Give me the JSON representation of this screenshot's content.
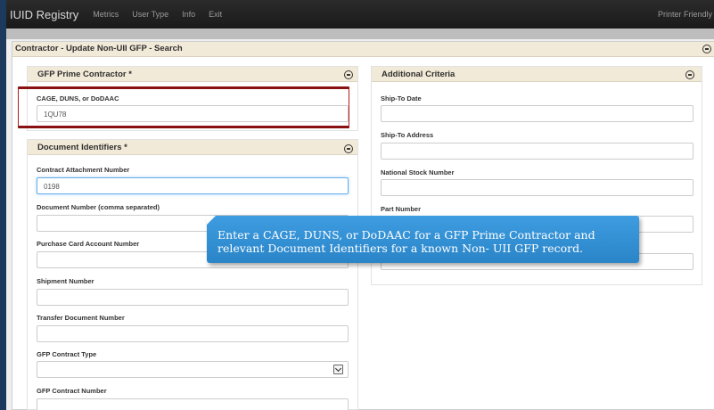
{
  "navbar": {
    "brand": "IUID Registry",
    "links": [
      "Metrics",
      "User Type",
      "Info",
      "Exit"
    ],
    "printer_friendly": "Printer Friendly"
  },
  "page": {
    "title": "Contractor - Update Non-UII GFP - Search"
  },
  "gfp_prime_contractor": {
    "title": "GFP Prime Contractor *",
    "cage_label": "CAGE, DUNS, or DoDAAC",
    "cage_value": "1QU78"
  },
  "document_identifiers": {
    "title": "Document Identifiers *",
    "fields": [
      {
        "label": "Contract Attachment Number",
        "value": "0198"
      },
      {
        "label": "Document Number (comma separated)",
        "value": ""
      },
      {
        "label": "Purchase Card Account Number",
        "value": ""
      },
      {
        "label": "Shipment Number",
        "value": ""
      },
      {
        "label": "Transfer Document Number",
        "value": ""
      }
    ],
    "contract_type_label": "GFP Contract Type",
    "contract_type_value": "",
    "contract_number_label": "GFP Contract Number"
  },
  "additional_criteria": {
    "title": "Additional Criteria",
    "fields": [
      {
        "label": "Ship-To Date",
        "value": ""
      },
      {
        "label": "Ship-To Address",
        "value": ""
      },
      {
        "label": "National Stock Number",
        "value": ""
      },
      {
        "label": "Part Number",
        "value": ""
      },
      {
        "label": "",
        "value": ""
      }
    ]
  },
  "callout": {
    "line1": "Enter a CAGE, DUNS, or DoDAAC for a GFP Prime Contractor and",
    "line2": "relevant Document Identifiers for a known Non- UII GFP record."
  },
  "colors": {
    "navbar": "#1f1f1f",
    "panel_header": "#f2ead8",
    "highlight_border": "#b31b1b",
    "callout": "#2f8fd6",
    "focus_border": "#66afe9"
  },
  "icons": {
    "collapse": "minus-circle-icon",
    "select": "chevron-down-icon"
  }
}
